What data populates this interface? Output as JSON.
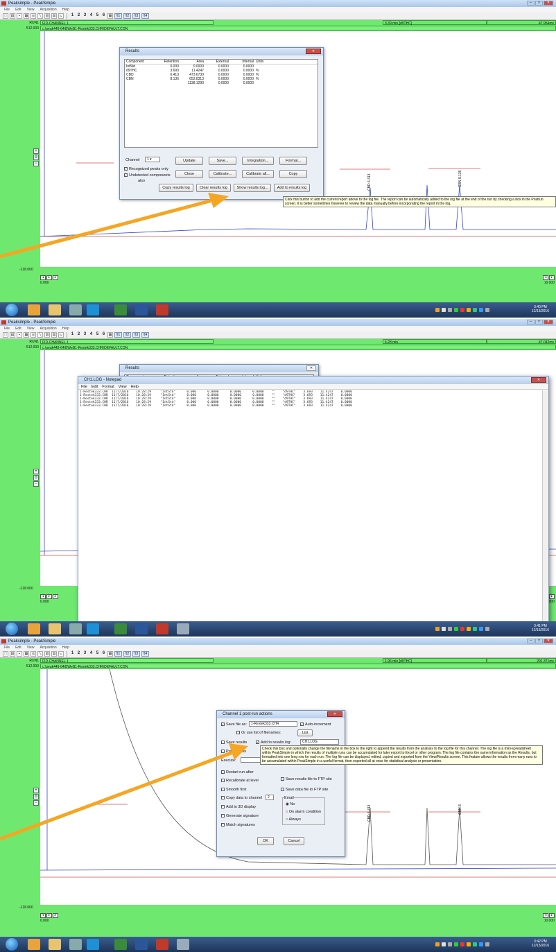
{
  "app": {
    "title": "Peaksimple - PeakSimple",
    "menus": [
      "File",
      "Edit",
      "View",
      "Acquisition",
      "Help"
    ]
  },
  "toolbar": {
    "numbers": [
      "1",
      "2",
      "3",
      "4",
      "5",
      "6"
    ],
    "channels": [
      "§1",
      "§2",
      "§3",
      "§4"
    ]
  },
  "shared": {
    "run_label": "RUN1",
    "ymax": "512.000",
    "ymin": "-128.000",
    "xmin": "0.000",
    "xmax": "10.000",
    "channel": "FID-CHANNEL 1",
    "file": "c:\\peak449-64\\BWeB1-Restek333.CHR\\DEFAULT.CON"
  },
  "panel1": {
    "time": "3.39 min [d9THC]",
    "value": "47.954mv",
    "peak_labels": [
      "CBD 6.413",
      "CBN 8.136"
    ],
    "results": {
      "title": "Results",
      "columns": [
        "Component",
        "Retention",
        "Area",
        "External",
        "Internal",
        "Units"
      ],
      "rows": [
        [
          "IntStd",
          "0.000",
          "0.0000",
          "0.0000",
          "0.0000",
          ""
        ],
        [
          "d9THC",
          "3.693",
          "11.4247",
          "0.0000",
          "0.0000",
          "%"
        ],
        [
          "CBD",
          "6.413",
          "473.6730",
          "0.0000",
          "0.0000",
          "%"
        ],
        [
          "CBN",
          "8.136",
          "652.8313",
          "0.0000",
          "0.0000",
          "%"
        ],
        [
          "",
          "",
          "1138.1290",
          "0.0000",
          "0.0000",
          ""
        ]
      ],
      "channel_label": "Channel",
      "channel_value": "1",
      "recognized": "Recognized peaks only",
      "undetected": "Undetected components",
      "also": "also",
      "btns": [
        "Update",
        "Save...",
        "Integration...",
        "Format...",
        "Close",
        "Calibrate...",
        "Calibrate all...",
        "Copy",
        "Copy results log",
        "Clear results log",
        "Show results log...",
        "Add to results log"
      ]
    },
    "tooltip": "Click this button to add the current report above to the log file. The report can be automatically added to the log file at the end of the run by checking a box in the Postrun screen. It is better sometimes however to review the data manually before incorporating the report in the log.",
    "clock": {
      "time": "3:40 PM",
      "date": "12/13/2016"
    }
  },
  "panel2": {
    "time": "4.28 min",
    "value": "47.042mv",
    "results_title": "Results",
    "notepad": {
      "title": "CH1.LOG - Notepad",
      "menus": [
        "File",
        "Edit",
        "Format",
        "View",
        "Help"
      ],
      "lines": [
        "1-Restek333.CHR  11/7/2016    10:28:29     \"IntStd\"      0.000      0.0000      0.0000      0.0000    \"\"    \"d9THC\"    3.693    11.4247    0.0000",
        "1-Restek333.CHR  11/7/2016    10:28:29     \"IntStd\"      0.000      0.0000      0.0000      0.0000    \"\"    \"d9THC\"    3.693    11.4247    0.0000",
        "1-Restek333.CHR  11/7/2016    10:28:29     \"IntStd\"      0.000      0.0000      0.0000      0.0000    \"\"    \"d9THC\"    3.693    11.4247    0.0000",
        "1-Restek333.CHR  11/7/2016    10:28:29     \"IntStd\"      0.000      0.0000      0.0000      0.0000    \"\"    \"d9THC\"    3.693    11.4247    0.0000",
        "1-Restek333.CHR  11/7/2016    10:28:29     \"IntStd\"      0.000      0.0000      0.0000      0.0000    \"\"    \"d9THC\"    3.693    11.4247    0.0000"
      ]
    },
    "clock": {
      "time": "3:41 PM",
      "date": "12/13/2016"
    }
  },
  "panel3": {
    "time": "1.96 min [d9THC]",
    "value": "291.371mv",
    "peak_labels": [
      "CBD 6.413",
      "CBN 8."
    ],
    "postrun": {
      "title": "Channel 1 post-run actions",
      "save_file": "Save file as:",
      "save_file_value": "1-Restek333.CHR",
      "auto_inc": "Auto-increment",
      "use_list": "Or use list of filenames:",
      "list_btn": "List",
      "save_results": "Save results",
      "add_log": "Add to results log:",
      "log_value": "CH1.LOG",
      "print_results": "Print results",
      "execute": "Execute:",
      "restart": "Restart run after",
      "recalibrate": "Recalibrate at level",
      "smooth": "Smooth first",
      "copy_data": "Copy data to channel",
      "copy_value": "2",
      "add3d": "Add to 3D display",
      "gen_sig": "Generate signature",
      "match_sig": "Match signatures",
      "ftp_results": "Save results file to FTP site",
      "ftp_data": "Save data file to FTP site",
      "email": "Email",
      "email_opts": [
        "No",
        "On alarm condition",
        "Always"
      ],
      "ok": "OK",
      "cancel": "Cancel"
    },
    "tooltip": "Check this box and optionally change the filename in the box to the right to append the results from the analysis to the log file for this channel. The log file is a mini-spreadsheet within PeakSimple in which the results of multiple runs can be accumulated for later export to Excel or other program. The log file contains the same information as the Results, but formatted into one long row for each run. The log file can be displayed, edited, copied and exported from the View/Results screen. This feature allows the results from many runs to be accumulated within PeakSimple in a useful format, then exported all at once for statistical analysis or presentation.",
    "clock": {
      "time": "3:42 PM",
      "date": "12/13/2016"
    }
  },
  "colors": {
    "panel_green": "#6fe86f",
    "accent_arrow": "#f5a623",
    "trace": "#3344cc"
  }
}
